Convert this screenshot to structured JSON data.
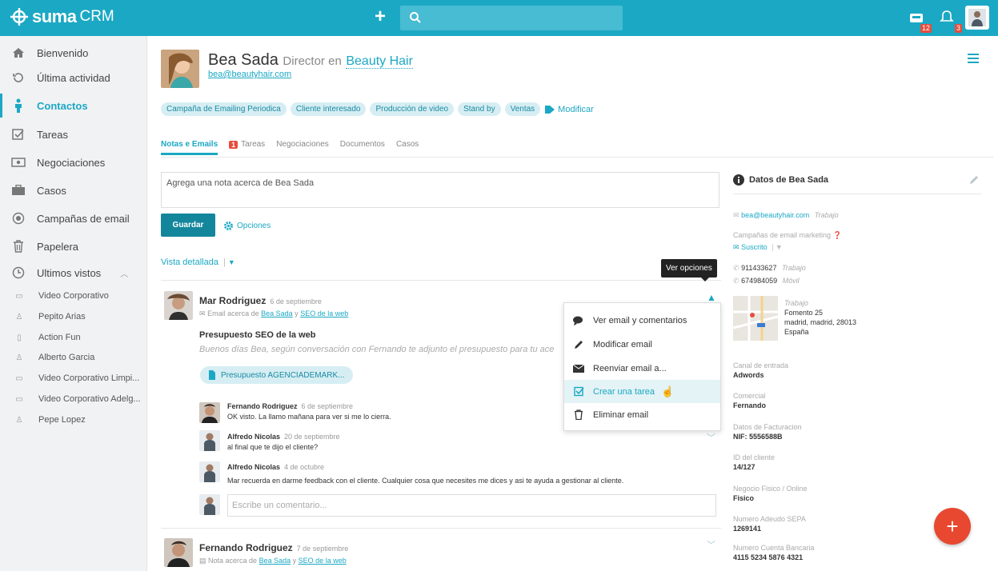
{
  "topbar": {
    "logo_bold": "suma",
    "logo_light": "CRM",
    "inbox_badge": "12",
    "notif_badge": "3"
  },
  "sidebar": {
    "items": [
      {
        "label": "Bienvenido"
      },
      {
        "label": "Última actividad"
      },
      {
        "label": "Contactos"
      },
      {
        "label": "Tareas"
      },
      {
        "label": "Negociaciones"
      },
      {
        "label": "Casos"
      },
      {
        "label": "Campañas de email"
      },
      {
        "label": "Papelera"
      },
      {
        "label": "Ultimos vistos"
      }
    ],
    "recent": [
      "Video Corporativo",
      "Pepito Arias",
      "Action Fun",
      "Alberto Garcia",
      "Video Corporativo Limpi...",
      "Video Corporativo Adelg...",
      "Pepe Lopez"
    ]
  },
  "contact": {
    "name": "Bea Sada",
    "role": "Director en",
    "company": "Beauty Hair",
    "email": "bea@beautyhair.com"
  },
  "tags": [
    "Campaña de Emailing Periodica",
    "Cliente interesado",
    "Producción de video",
    "Stand by",
    "Ventas"
  ],
  "tags_modify": "Modificar",
  "tabs": {
    "notes": "Notas e Emails",
    "tasks_badge": "1",
    "tasks": "Tareas",
    "deals": "Negociaciones",
    "docs": "Documentos",
    "cases": "Casos"
  },
  "note": {
    "placeholder": "Agrega una nota acerca de Bea Sada",
    "save": "Guardar",
    "options": "Opciones"
  },
  "view": {
    "label": "Vista detallada"
  },
  "entry1": {
    "author": "Mar Rodriguez",
    "date": "6 de septiembre",
    "sub_prefix": "Email acerca de",
    "sub_a": "Bea Sada",
    "sub_y": "y",
    "sub_b": "SEO de la web",
    "subject": "Presupuesto SEO de la web",
    "body": "Buenos días Bea, según conversación con Fernando te adjunto el presupuesto para tu ace",
    "attachment": "Presupuesto AGENCIADEMARK..."
  },
  "comments": [
    {
      "author": "Fernando Rodriguez",
      "date": "6 de septiembre",
      "text": "OK visto. La llamo mañana para ver si me lo cierra."
    },
    {
      "author": "Alfredo Nicolas",
      "date": "20 de septiembre",
      "text": "al final que te dijo el cliente?"
    },
    {
      "author": "Alfredo Nicolas",
      "date": "4 de octubre",
      "text": "Mar recuerda en darme feedback con el cliente. Cualquier cosa que necesites me dices y asi te ayuda a gestionar al cliente."
    }
  ],
  "comment_placeholder": "Escribe un comentario...",
  "entry2": {
    "author": "Fernando Rodriguez",
    "date": "7 de septiembre",
    "sub_prefix": "Nota acerca de",
    "sub_a": "Bea Sada",
    "sub_y": "y",
    "sub_b": "SEO de la web"
  },
  "tooltip": "Ver opciones",
  "menu": [
    "Ver email y comentarios",
    "Modificar email",
    "Reenviar email a...",
    "Crear una tarea",
    "Eliminar email"
  ],
  "details": {
    "title": "Datos de Bea Sada",
    "email": "bea@beautyhair.com",
    "email_type": "Trabajo",
    "campaigns_label": "Campañas de email marketing",
    "subscribed": "Suscrito",
    "phone1": "911433627",
    "phone1_type": "Trabajo",
    "phone2": "674984059",
    "phone2_type": "Móvil",
    "addr_type": "Trabajo",
    "addr1": "Fomento 25",
    "addr2": "madrid, madrid, 28013",
    "addr3": "España",
    "fields": [
      {
        "label": "Canal de entrada",
        "value": "Adwords"
      },
      {
        "label": "Comercial",
        "value": "Fernando"
      },
      {
        "label": "Datos de Facturacion",
        "value": "NIF: 5556588B"
      },
      {
        "label": "ID del cliente",
        "value": "14/127"
      },
      {
        "label": "Negocio Fisico / Online",
        "value": "Fisico"
      },
      {
        "label": "Numero Adeudo SEPA",
        "value": "1269141"
      },
      {
        "label": "Numero Cuenta Bancaria",
        "value": "4115 5234 5876 4321"
      }
    ]
  },
  "colors": {
    "brand": "#1ba8c4",
    "fab": "#e7482f",
    "badge": "#e74c3c"
  }
}
